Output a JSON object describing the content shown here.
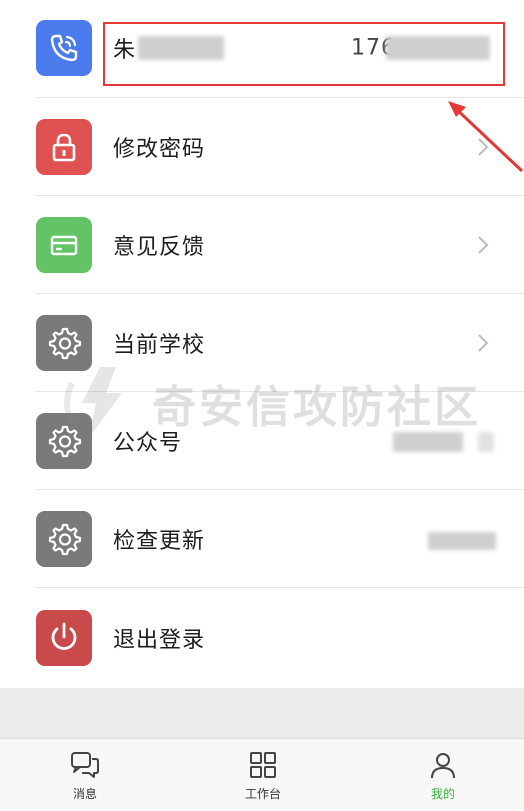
{
  "profile": {
    "name_prefix": "朱",
    "phone_prefix": "176"
  },
  "menu": [
    {
      "label": "修改密码",
      "icon": "lock-icon",
      "color": "#e05252"
    },
    {
      "label": "意见反馈",
      "icon": "card-icon",
      "color": "#62c464"
    },
    {
      "label": "当前学校",
      "icon": "gear-icon",
      "color": "#7a7a7a"
    },
    {
      "label": "公众号",
      "icon": "gear-icon",
      "color": "#7a7a7a"
    },
    {
      "label": "检查更新",
      "icon": "gear-icon",
      "color": "#7a7a7a"
    },
    {
      "label": "退出登录",
      "icon": "power-icon",
      "color": "#c84a4a"
    }
  ],
  "watermark": "奇安信攻防社区",
  "tabs": [
    {
      "label": "消息",
      "icon": "chat-icon"
    },
    {
      "label": "工作台",
      "icon": "grid-icon"
    },
    {
      "label": "我的",
      "icon": "user-icon"
    }
  ],
  "colors": {
    "active_tab": "#3cae3c",
    "phone_tile": "#4b7bec",
    "highlight_box": "#e53935"
  }
}
